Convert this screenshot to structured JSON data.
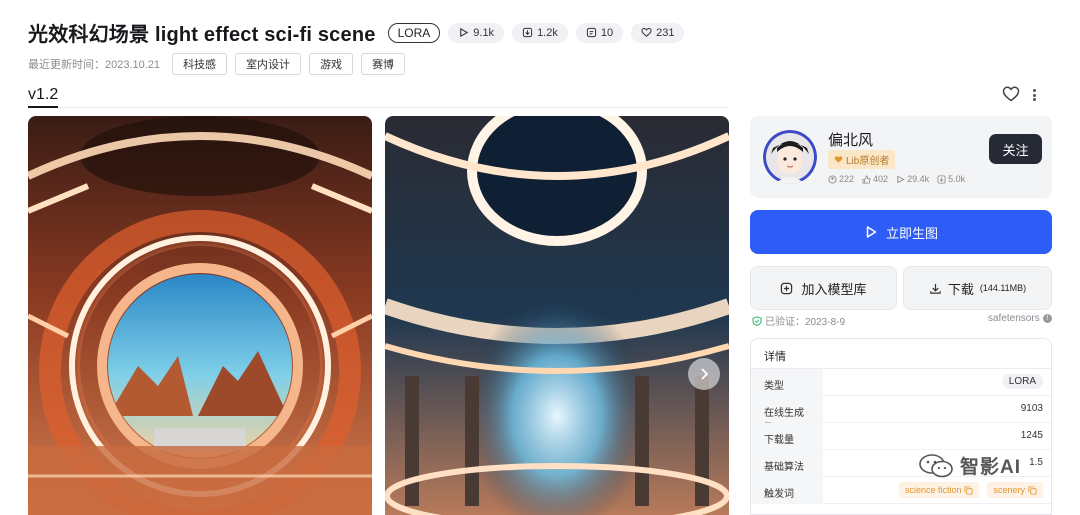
{
  "header": {
    "title": "光效科幻场景 light effect sci-fi scene",
    "model_type": "LORA",
    "stats": {
      "runs": "9.1k",
      "downloads": "1.2k",
      "comments": "10",
      "likes": "231"
    },
    "updated": "最近更新时间：2023.10.21",
    "tags": [
      "科技感",
      "室内设计",
      "游戏",
      "赛博"
    ]
  },
  "version": "v1.2",
  "author": {
    "name": "偏北风",
    "badge": "Lib原创者",
    "stats": {
      "followers": "222",
      "likes": "402",
      "runs": "29.4k",
      "downloads": "5.0k"
    },
    "follow_label": "关注"
  },
  "actions": {
    "generate_label": "立即生图",
    "add_library_label": "加入模型库",
    "download_label": "下载",
    "download_size": "(144.11MB)"
  },
  "verification": {
    "verified_text": "已验证：2023-8-9",
    "format": "safetensors"
  },
  "details": {
    "title": "详情",
    "rows": [
      {
        "key": "类型",
        "value": "LORA"
      },
      {
        "key": "在线生成数",
        "value": "9103"
      },
      {
        "key": "下载量",
        "value": "1245"
      },
      {
        "key": "基础算法",
        "value": "1.5"
      },
      {
        "key": "触发词",
        "tags": [
          "science fiction",
          "scenery"
        ]
      }
    ]
  },
  "watermark": "智影AI",
  "icons": {
    "runs": "play-icon",
    "downloads": "download-icon",
    "comments": "comment-icon",
    "likes": "heart-icon",
    "generate": "play-icon",
    "add_library": "plus-square-icon",
    "download": "download-icon",
    "verified": "shield-check-icon",
    "favorite": "heart-outline-icon",
    "more": "more-vertical-icon",
    "next": "chevron-right-icon",
    "copy": "copy-icon",
    "watermark_logo": "wechat-logo-icon"
  },
  "colors": {
    "primary_blue": "#2d5cf6",
    "follow_button": "#262a35",
    "badge_bg": "#fbe6c8",
    "trigger_tag": "#e3962e"
  }
}
